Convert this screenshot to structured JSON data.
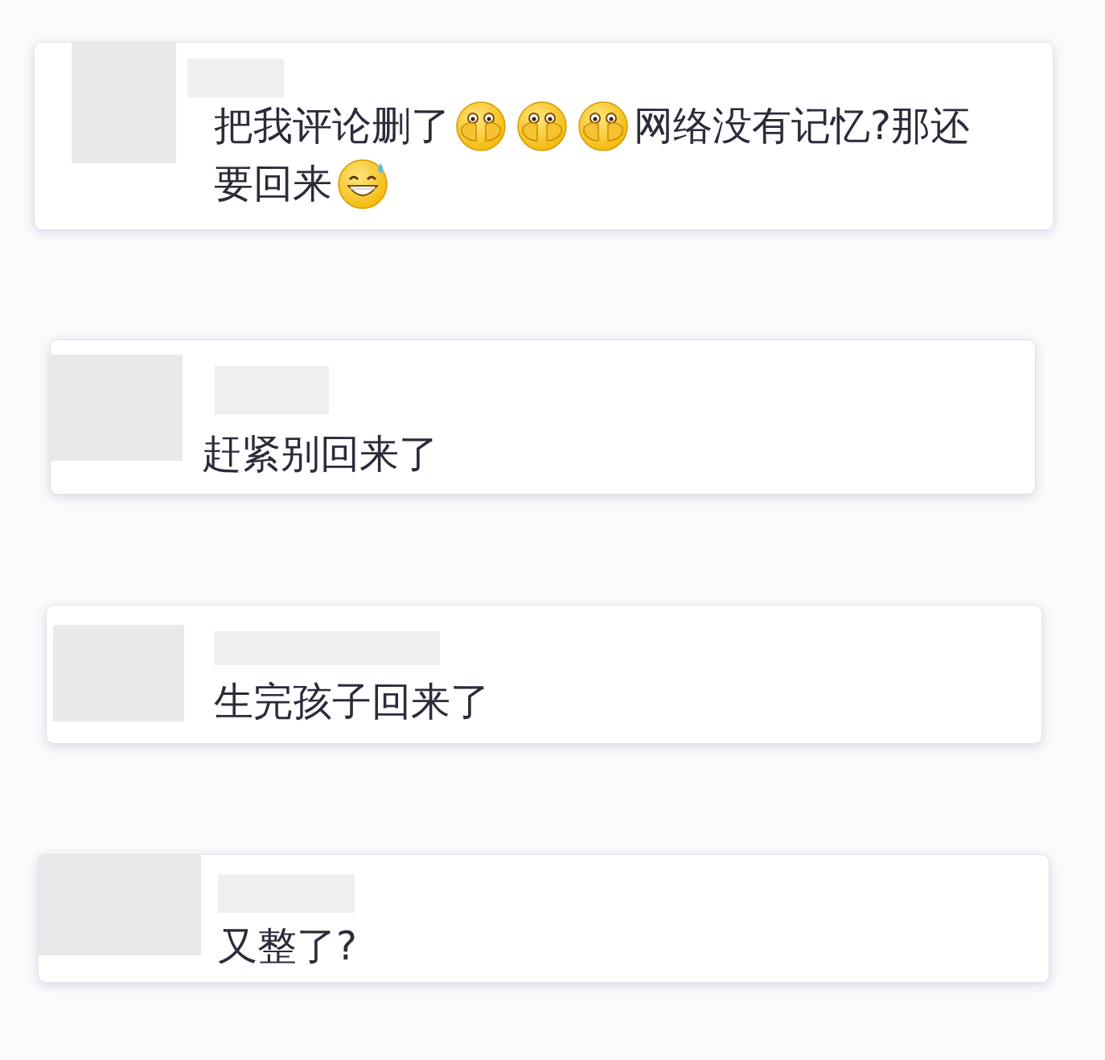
{
  "comments": [
    {
      "segments": [
        {
          "kind": "text",
          "text": "把我评论删了"
        },
        {
          "kind": "peek"
        },
        {
          "kind": "peek"
        },
        {
          "kind": "peek"
        },
        {
          "kind": "text",
          "text": "网络没有记忆?那还"
        },
        {
          "kind": "text",
          "text": "要回来"
        },
        {
          "kind": "sweat"
        }
      ]
    },
    {
      "segments": [
        {
          "kind": "text",
          "text": "赶紧别回来了"
        }
      ]
    },
    {
      "segments": [
        {
          "kind": "text",
          "text": "生完孩子回来了"
        }
      ]
    },
    {
      "segments": [
        {
          "kind": "text",
          "text": "又整了?"
        }
      ]
    }
  ]
}
